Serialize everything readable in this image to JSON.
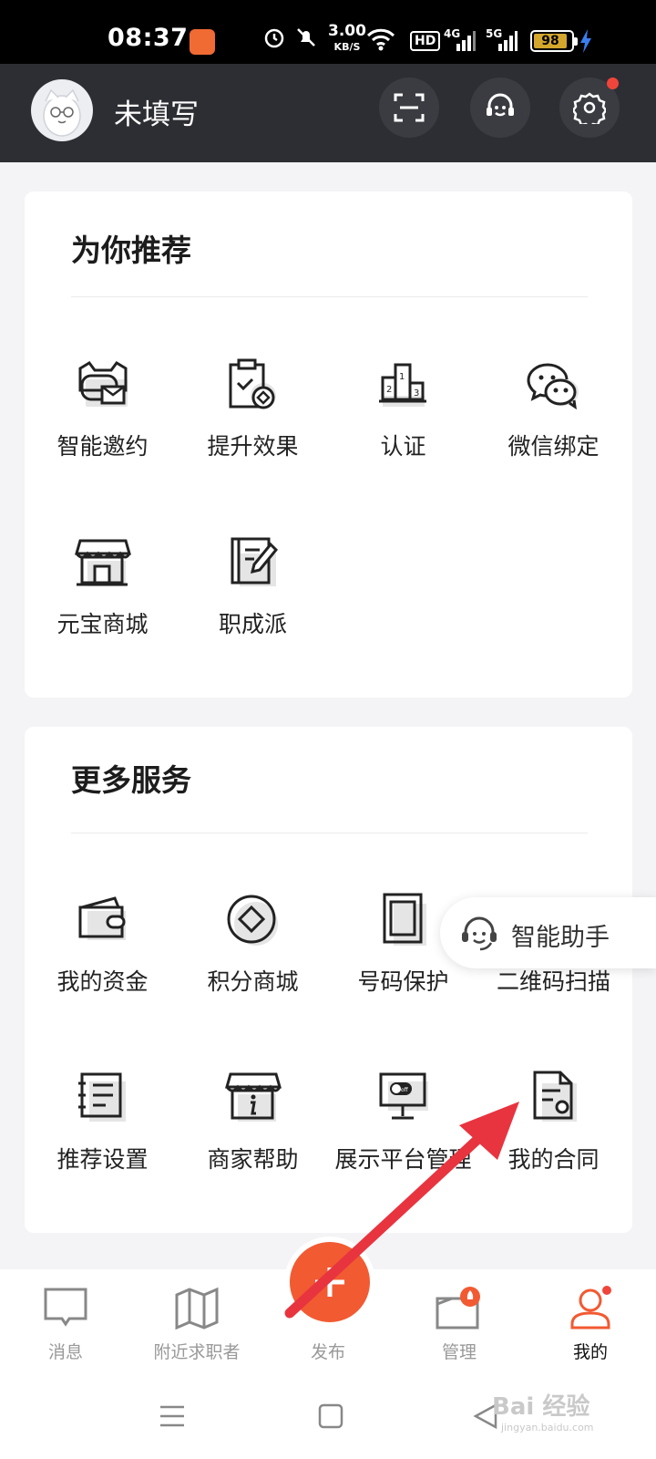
{
  "status_bar": {
    "time": "08:37",
    "speed_value": "3.00",
    "speed_unit": "KB/S",
    "hd_label": "HD",
    "net1": "4G",
    "net2": "5G",
    "battery": "98"
  },
  "header": {
    "username": "未填写"
  },
  "recommend": {
    "title": "为你推荐",
    "items": [
      {
        "label": "智能邀约",
        "icon": "robot-mail-icon"
      },
      {
        "label": "提升效果",
        "icon": "clipboard-coin-icon"
      },
      {
        "label": "认证",
        "icon": "podium-icon"
      },
      {
        "label": "微信绑定",
        "icon": "wechat-icon"
      },
      {
        "label": "元宝商城",
        "icon": "storefront-icon"
      },
      {
        "label": "职成派",
        "icon": "notebook-pen-icon"
      }
    ]
  },
  "more_services": {
    "title": "更多服务",
    "items": [
      {
        "label": "我的资金",
        "icon": "wallet-icon"
      },
      {
        "label": "积分商城",
        "icon": "points-coin-icon"
      },
      {
        "label": "号码保护",
        "icon": "tablet-icon"
      },
      {
        "label": "二维码扫描",
        "icon": "qr-scan-icon"
      },
      {
        "label": "推荐设置",
        "icon": "list-settings-icon"
      },
      {
        "label": "商家帮助",
        "icon": "store-info-icon"
      },
      {
        "label": "展示平台管理",
        "icon": "monitor-toggle-icon"
      },
      {
        "label": "我的合同",
        "icon": "contract-icon"
      }
    ]
  },
  "assistant": {
    "label": "智能助手"
  },
  "bottom_nav": {
    "items": [
      {
        "label": "消息"
      },
      {
        "label": "附近求职者"
      },
      {
        "label": "发布"
      },
      {
        "label": "管理"
      },
      {
        "label": "我的"
      }
    ],
    "active_index": 4
  },
  "watermark": {
    "text": "Bai 经验",
    "sub": "jingyan.baidu.com"
  }
}
